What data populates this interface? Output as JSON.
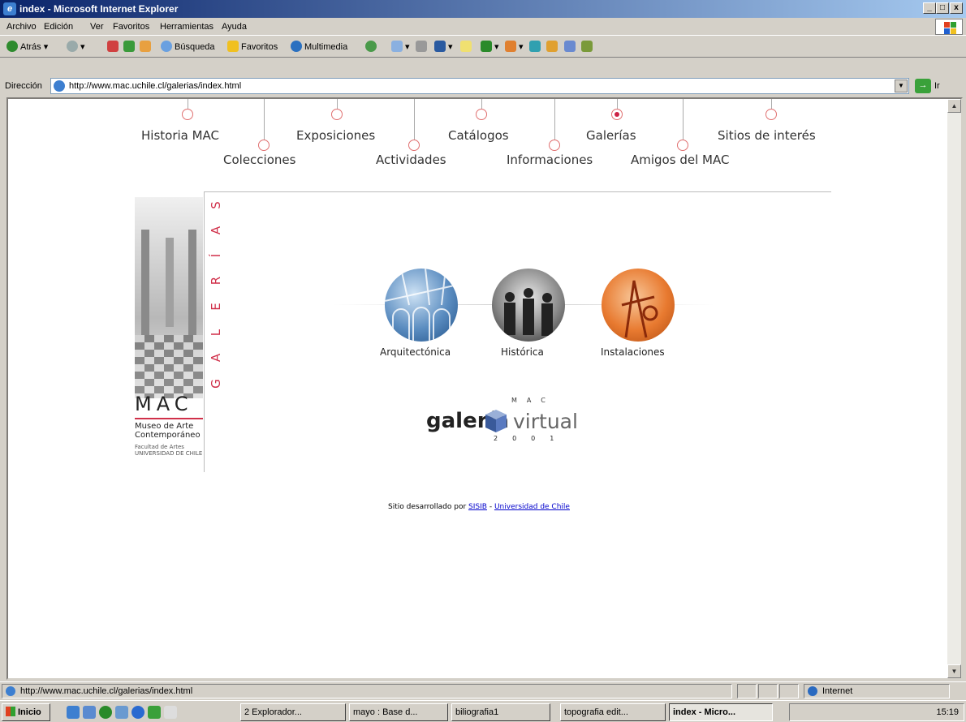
{
  "window": {
    "title": "index - Microsoft Internet Explorer"
  },
  "menu": [
    "Archivo",
    "Edición",
    "Ver",
    "Favoritos",
    "Herramientas",
    "Ayuda"
  ],
  "toolbar": {
    "back": "Atrás",
    "search": "Búsqueda",
    "favorites": "Favoritos",
    "media": "Multimedia"
  },
  "address": {
    "label": "Dirección",
    "url": "http://www.mac.uchile.cl/galerias/index.html",
    "go": "Ir"
  },
  "nav": {
    "top": [
      "Historia MAC",
      "Exposiciones",
      "Catálogos",
      "Galerías",
      "Sitios de interés"
    ],
    "bottom": [
      "Colecciones",
      "Actividades",
      "Informaciones",
      "Amigos del MAC"
    ],
    "active": "Galerías"
  },
  "side": {
    "letters": [
      "S",
      "A",
      "Í",
      "R",
      "E",
      "L",
      "A",
      "G"
    ],
    "logo": "MAC",
    "museo_line1": "Museo de Arte",
    "museo_line2": "Contemporáneo",
    "facultad_line1": "Facultad de Artes",
    "facultad_line2": "UNIVERSIDAD DE CHILE"
  },
  "galleries": [
    "Arquitectónica",
    "Histórica",
    "Instalaciones"
  ],
  "galeria_virtual": {
    "mac": "MAC",
    "word1": "galería",
    "word2": "virtual",
    "year": "2001"
  },
  "credit": {
    "text": "Sitio desarrollado por",
    "link1": "SISIB",
    "sep": "-",
    "link2": "Universidad de Chile"
  },
  "status": {
    "url": "http://www.mac.uchile.cl/galerias/index.html",
    "zone": "Internet"
  },
  "taskbar": {
    "start": "Inicio",
    "tasks": [
      "2 Explorador...",
      "mayo : Base d...",
      "biliografia1",
      "topografia edit...",
      "index - Micro..."
    ],
    "time": "15:19"
  }
}
